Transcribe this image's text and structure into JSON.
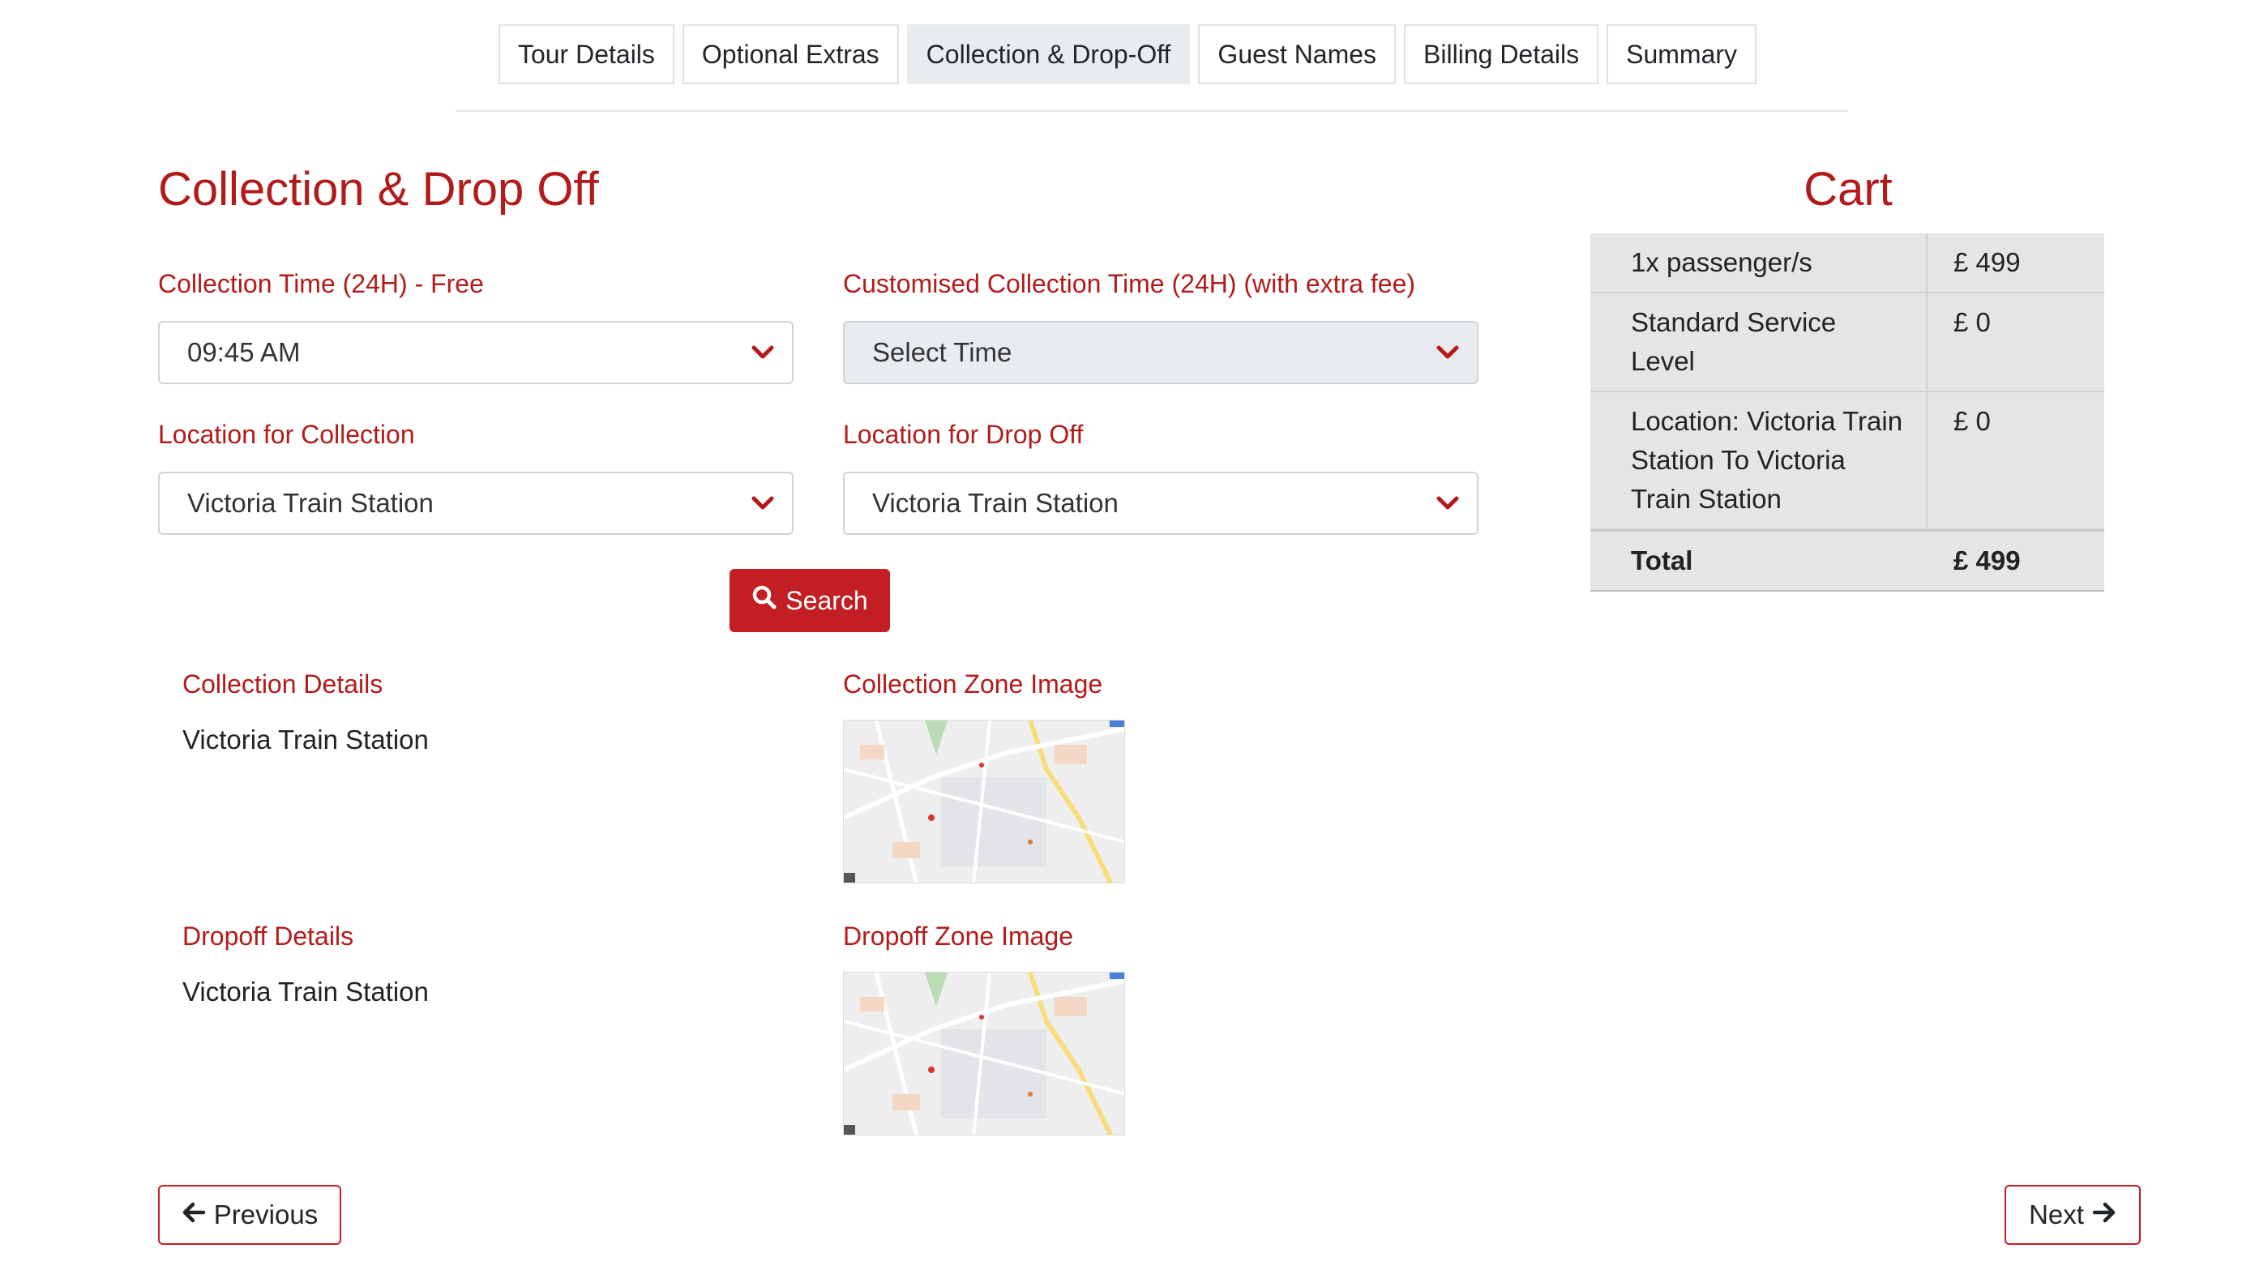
{
  "tabs": [
    {
      "label": "Tour Details"
    },
    {
      "label": "Optional Extras"
    },
    {
      "label": "Collection & Drop-Off",
      "active": true
    },
    {
      "label": "Guest Names"
    },
    {
      "label": "Billing Details"
    },
    {
      "label": "Summary"
    }
  ],
  "page": {
    "title": "Collection & Drop Off"
  },
  "form": {
    "collection_time_label": "Collection Time (24H) - Free",
    "collection_time_value": "09:45 AM",
    "custom_time_label": "Customised Collection Time (24H) (with extra fee)",
    "custom_time_value": "Select Time",
    "collection_location_label": "Location for Collection",
    "collection_location_value": "Victoria Train Station",
    "dropoff_location_label": "Location for Drop Off",
    "dropoff_location_value": "Victoria Train Station",
    "search_label": "Search"
  },
  "details": {
    "collection_label": "Collection Details",
    "collection_value": "Victoria Train Station",
    "collection_zone_label": "Collection Zone Image",
    "dropoff_label": "Dropoff Details",
    "dropoff_value": "Victoria Train Station",
    "dropoff_zone_label": "Dropoff Zone Image"
  },
  "cart": {
    "title": "Cart",
    "rows": [
      {
        "desc": "1x passenger/s",
        "price": "£ 499"
      },
      {
        "desc": "Standard Service Level",
        "price": "£ 0"
      },
      {
        "desc": "Location: Victoria Train Station To Victoria Train Station",
        "price": "£ 0"
      }
    ],
    "total_label": "Total",
    "total_price": "£ 499"
  },
  "nav": {
    "previous_label": "Previous",
    "next_label": "Next"
  },
  "colors": {
    "accent": "#b31b1b",
    "button": "#c21e24"
  }
}
